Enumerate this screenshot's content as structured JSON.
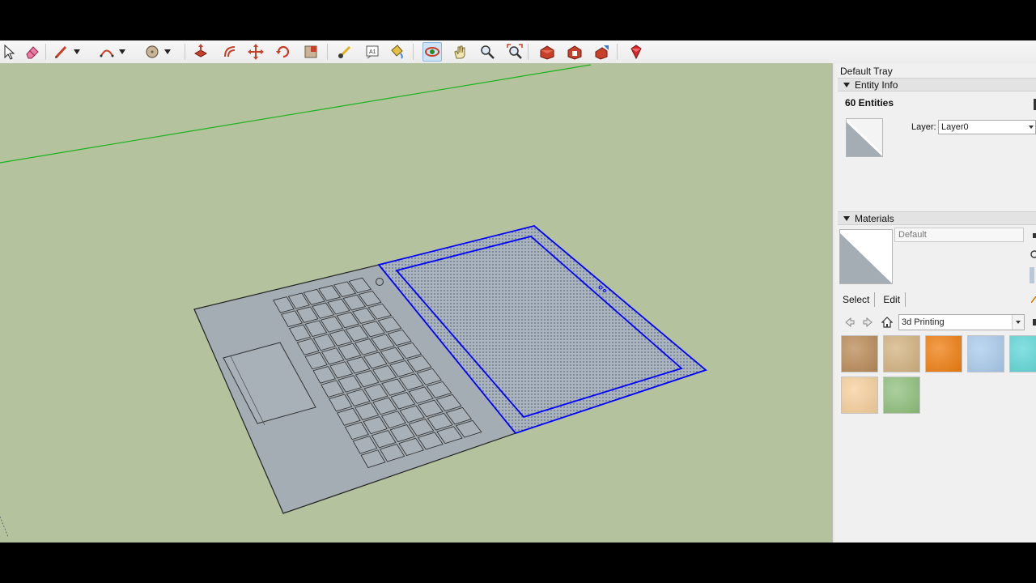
{
  "toolbar": {
    "tools": [
      {
        "icon": "select-arrow-icon"
      },
      {
        "icon": "eraser-icon"
      },
      {
        "icon": "line-pencil-icon",
        "dropdown": true
      },
      {
        "icon": "arc-icon",
        "dropdown": true
      },
      {
        "icon": "circle-shape-icon",
        "dropdown": true
      },
      {
        "icon": "push-pull-icon"
      },
      {
        "icon": "offset-icon"
      },
      {
        "icon": "move-icon"
      },
      {
        "icon": "rotate-icon"
      },
      {
        "icon": "scale-icon"
      },
      {
        "icon": "tape-measure-icon"
      },
      {
        "icon": "text-tool-icon"
      },
      {
        "icon": "paint-bucket-icon"
      },
      {
        "icon": "orbit-icon",
        "active": true
      },
      {
        "icon": "pan-hand-icon"
      },
      {
        "icon": "zoom-icon"
      },
      {
        "icon": "zoom-extents-icon"
      },
      {
        "icon": "3d-warehouse-icon"
      },
      {
        "icon": "extension-warehouse-icon"
      },
      {
        "icon": "share-model-icon"
      },
      {
        "icon": "ruby-extension-icon"
      }
    ]
  },
  "tray": {
    "title": "Default Tray",
    "entity_info": {
      "header": "Entity Info",
      "count_label": "60 Entities",
      "layer_label": "Layer:",
      "layer_value": "Layer0"
    },
    "materials": {
      "header": "Materials",
      "name_value": "Default",
      "tab_select": "Select",
      "tab_edit": "Edit",
      "collection": "3d Printing",
      "swatches": [
        {
          "color": "#b98a56"
        },
        {
          "color": "#d3b27f"
        },
        {
          "color": "#ef7d0f"
        },
        {
          "color": "#a9cbec"
        },
        {
          "color": "#5ed6d6"
        },
        {
          "color": "#f6cf9c"
        },
        {
          "color": "#8fbf7c"
        }
      ]
    }
  },
  "colors": {
    "viewport_bg": "#b4c29d",
    "model_face": "#a4adb4",
    "selection": "#0000ff",
    "green_axis": "#1bb31b"
  }
}
